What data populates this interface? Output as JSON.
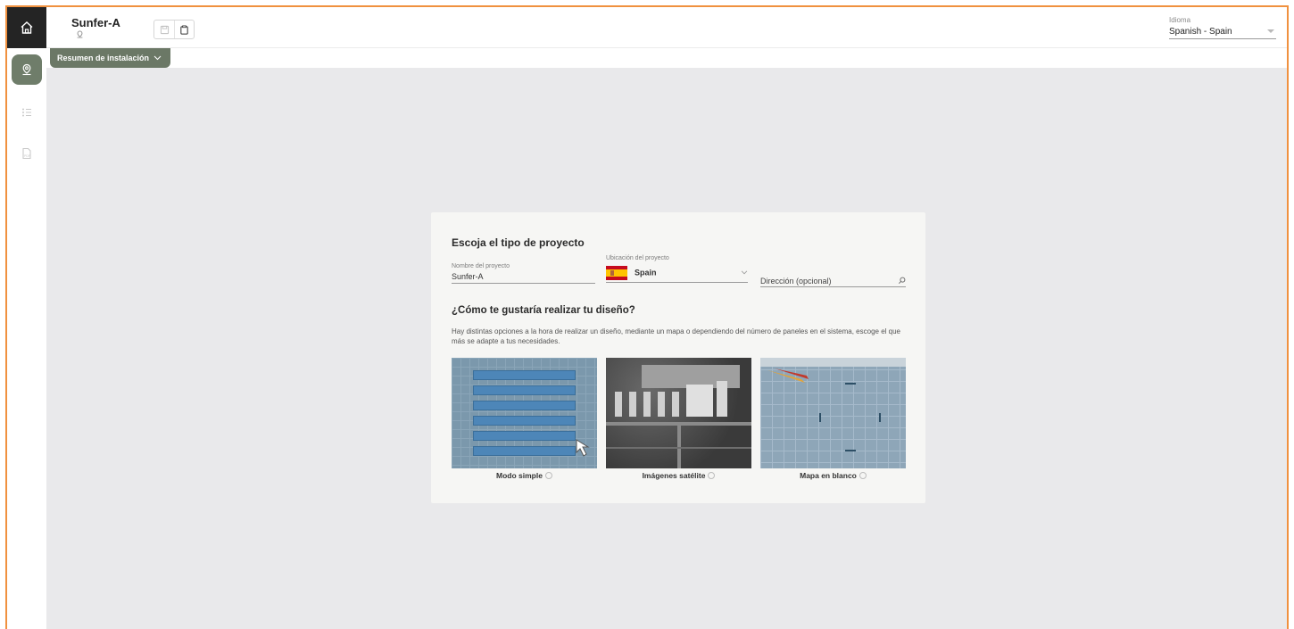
{
  "project": {
    "title": "Sunfer-A"
  },
  "language": {
    "label": "Idioma",
    "value": "Spanish - Spain"
  },
  "summary_label": "Resumen de instalación",
  "card": {
    "title": "Escoja el tipo de proyecto",
    "name_field": {
      "label": "Nombre del proyecto",
      "value": "Sunfer-A"
    },
    "location_field": {
      "label": "Ubicación del proyecto",
      "value": "Spain"
    },
    "address_field": {
      "placeholder": "Dirección (opcional)"
    },
    "question": "¿Cómo te gustaría realizar tu diseño?",
    "description": "Hay distintas opciones a la hora de realizar un diseño, mediante un mapa o dependiendo del número de paneles en el sistema, escoge el que más se adapte a tus necesidades.",
    "modes": [
      {
        "label": "Modo simple",
        "icon": "help-icon"
      },
      {
        "label": "Imágenes satélite",
        "icon": "help-icon"
      },
      {
        "label": "Mapa en blanco",
        "icon": "help-icon"
      }
    ]
  },
  "icons": {
    "home": "home-icon",
    "location": "location-pin-icon",
    "list": "list-icon",
    "pdf": "pdf-icon",
    "save": "save-icon",
    "clipboard": "clipboard-icon",
    "search": "search-icon"
  },
  "colors": {
    "accent": "#6f7d6a",
    "frame_border": "#f0913f",
    "home_bg": "#242424",
    "canvas": "#e9e9eb"
  }
}
